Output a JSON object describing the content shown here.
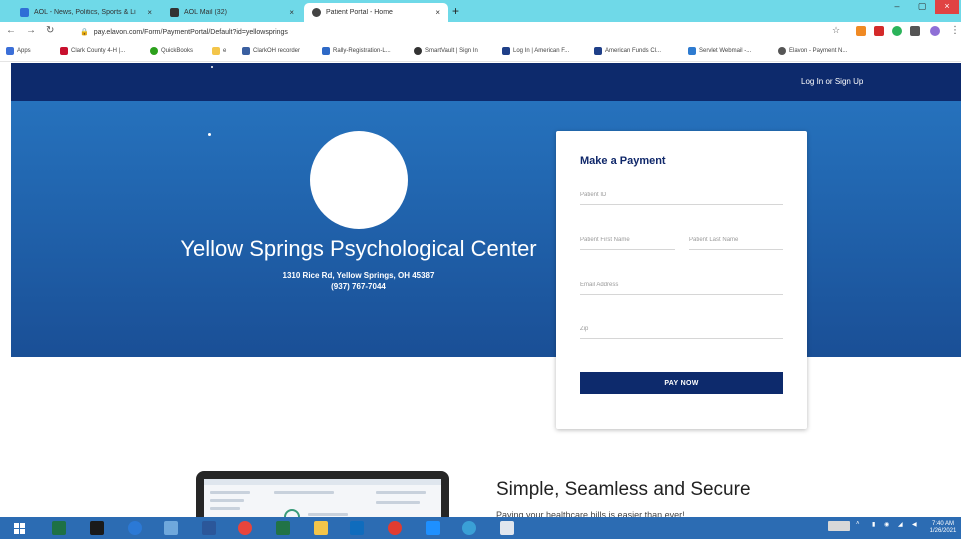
{
  "browser": {
    "tabs": [
      {
        "title": "AOL - News, Politics, Sports & Li",
        "icon": "aol-icon",
        "color": "#2f6fd6"
      },
      {
        "title": "AOL Mail (32)",
        "icon": "aol-mail-icon",
        "color": "#333333"
      },
      {
        "title": "Patient Portal - Home",
        "icon": "patient-portal-icon",
        "color": "#444444"
      }
    ],
    "url": "pay.elavon.com/Form/PaymentPortal/Default?id=yellowsprings",
    "bookmarks": [
      {
        "label": "Apps",
        "icon": "apps-grid-icon",
        "color": "#3b6fd8"
      },
      {
        "label": "Clark County 4-H |...",
        "icon": "clover-icon",
        "color": "#c8102e"
      },
      {
        "label": "QuickBooks",
        "icon": "quickbooks-icon",
        "color": "#2ca01c"
      },
      {
        "label": "e",
        "icon": "folder-icon",
        "color": "#f3c54a"
      },
      {
        "label": "ClarkOH recorder",
        "icon": "recorder-icon",
        "color": "#3a5fa0"
      },
      {
        "label": "Rally-Registration-L...",
        "icon": "rally-icon",
        "color": "#2e69c6"
      },
      {
        "label": "SmartVault | Sign In",
        "icon": "smartvault-icon",
        "color": "#333333"
      },
      {
        "label": "Log In | American F...",
        "icon": "american-funds-icon",
        "color": "#1f3f88"
      },
      {
        "label": "American Funds Cl...",
        "icon": "american-funds-icon",
        "color": "#1f3f88"
      },
      {
        "label": "Servlet Webmail -...",
        "icon": "webmail-icon",
        "color": "#2e7bd0"
      },
      {
        "label": "Elavon - Payment N...",
        "icon": "elavon-icon",
        "color": "#555555"
      }
    ]
  },
  "header": {
    "login": "Log In",
    "or": "or",
    "signup": "Sign Up"
  },
  "hero": {
    "name": "Yellow Springs Psychological Center",
    "address": "1310 Rice Rd, Yellow Springs, OH 45387",
    "phone": "(937) 767-7044"
  },
  "payment": {
    "title": "Make a Payment",
    "patient_id": "Patient ID",
    "first_name": "Patient First Name",
    "last_name": "Patient Last Name",
    "email": "Email Address",
    "zip": "Zip",
    "button": "PAY NOW"
  },
  "section": {
    "title": "Simple, Seamless and Secure",
    "subtitle": "Paying your healthcare bills is easier than ever!"
  },
  "taskbar": {
    "time": "7:40 AM",
    "date": "1/26/2021"
  },
  "colors": {
    "header_navy": "#0d2a6c",
    "hero_blue": "#2672bd",
    "button_navy": "#0d2a6c",
    "tabstrip_cyan": "#6fd9e8",
    "taskbar_blue": "#2c6cb3"
  }
}
